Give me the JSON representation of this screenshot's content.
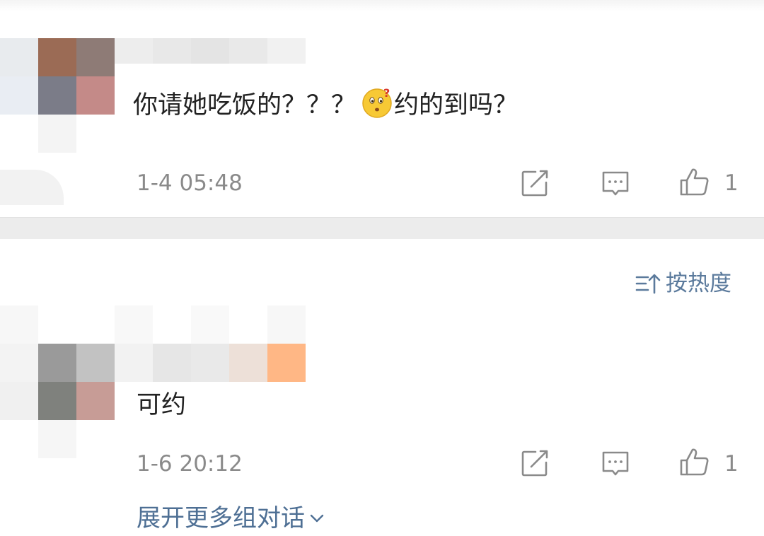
{
  "comments": [
    {
      "text_before_emoji": "你请她吃饭的？？？",
      "emoji": "confused-face-emoji",
      "text_after_emoji": "约的到吗？",
      "timestamp": "1-4 05:48",
      "like_count": "1"
    },
    {
      "text": "可约",
      "timestamp": "1-6 20:12",
      "like_count": "1"
    }
  ],
  "sort": {
    "label": "按热度",
    "icon": "sort-icon"
  },
  "expand": {
    "label": "展开更多组对话",
    "icon": "chevron-down-icon"
  },
  "icons": {
    "repost": "repost-icon",
    "reply": "comment-icon",
    "like": "thumbs-up-icon"
  },
  "colors": {
    "link": "#4e6f94",
    "meta": "#8a8a8a",
    "text": "#222222",
    "separator": "#ececec"
  }
}
